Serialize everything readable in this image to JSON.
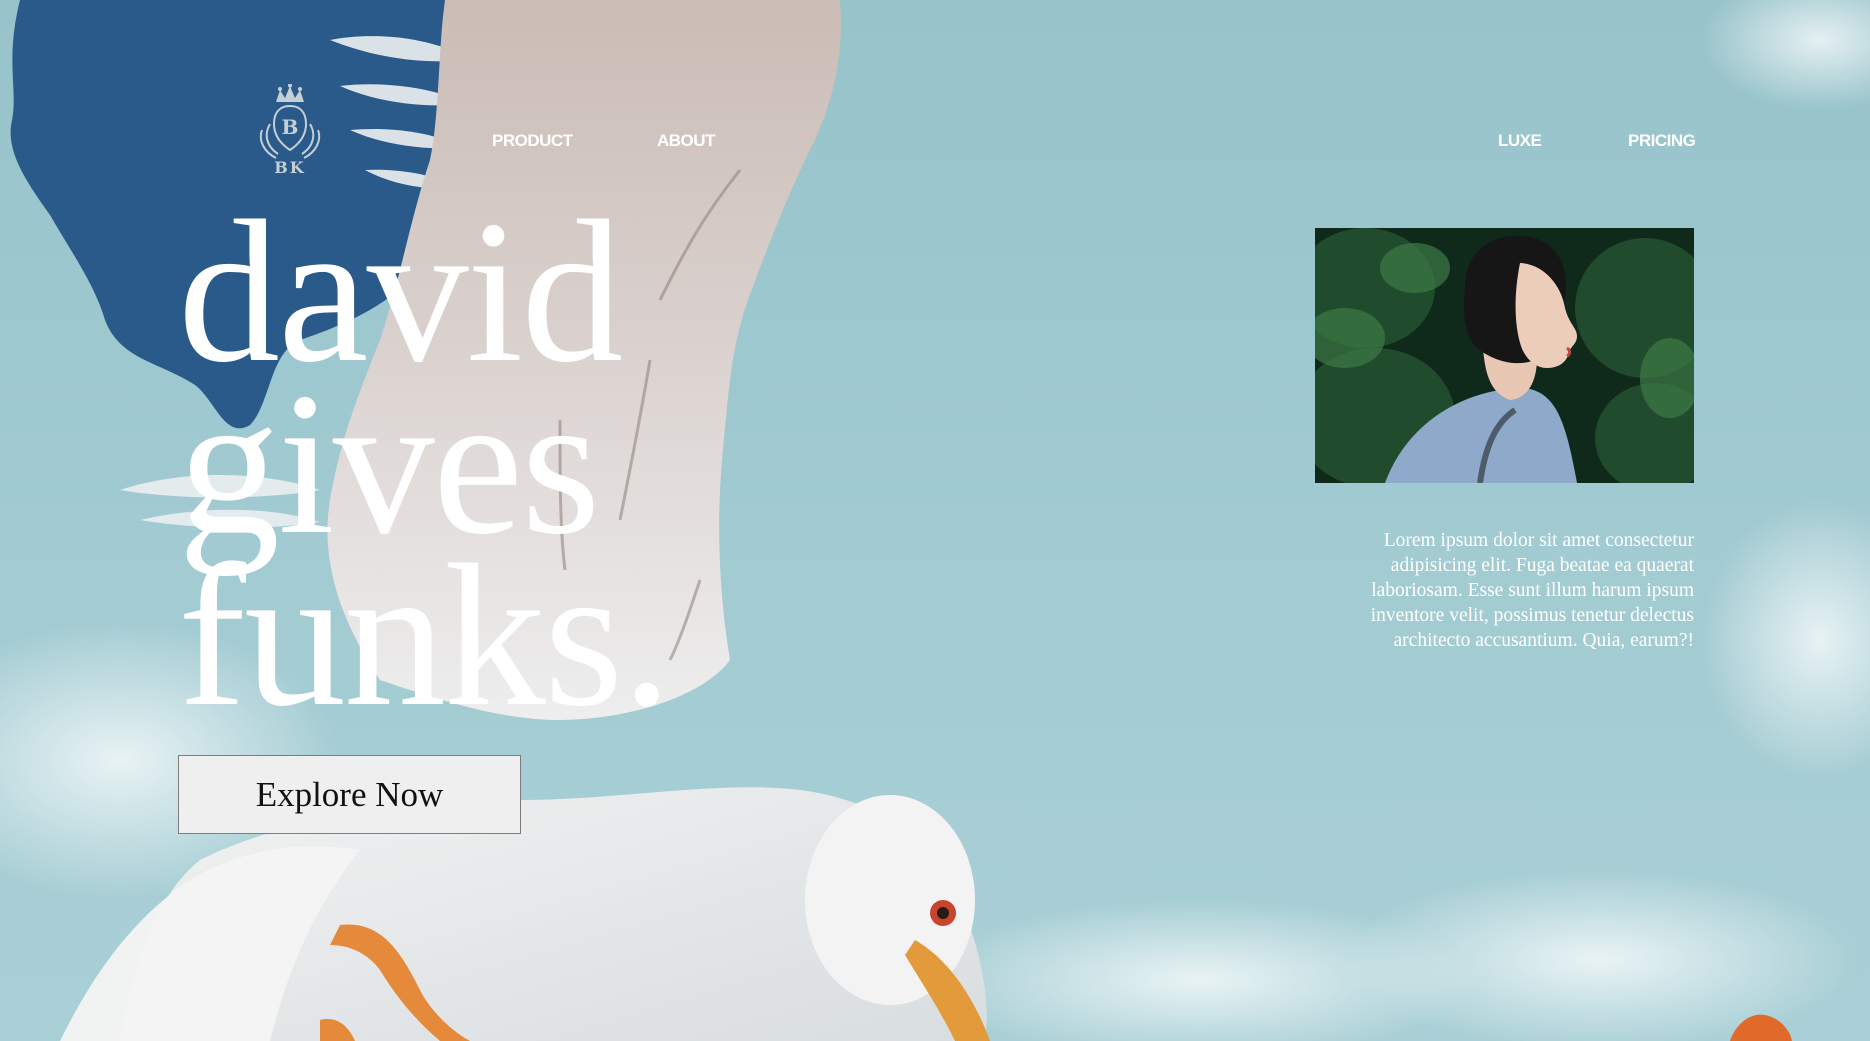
{
  "logo": {
    "letters": "BK",
    "crest_letter": "B"
  },
  "nav": {
    "left": [
      {
        "label": "PRODUCT"
      },
      {
        "label": "ABOUT"
      }
    ],
    "right": [
      {
        "label": "LUXE"
      },
      {
        "label": "PRICING"
      }
    ]
  },
  "hero": {
    "line1": "david",
    "line2": "gives",
    "line3": "funks.",
    "cta_label": "Explore Now"
  },
  "aside": {
    "blurb": "Lorem ipsum dolor sit amet consectetur adipisicing elit. Fuga beatae ea quaerat laboriosam. Esse sunt illum harum ipsum inventore velit, possimus tenetur delectus architecto accusantium. Quia, earum?!"
  },
  "colors": {
    "sky": "#9cc6cd",
    "blob": "#2a5a8a",
    "text": "#ffffff",
    "button_bg": "#efefef"
  }
}
